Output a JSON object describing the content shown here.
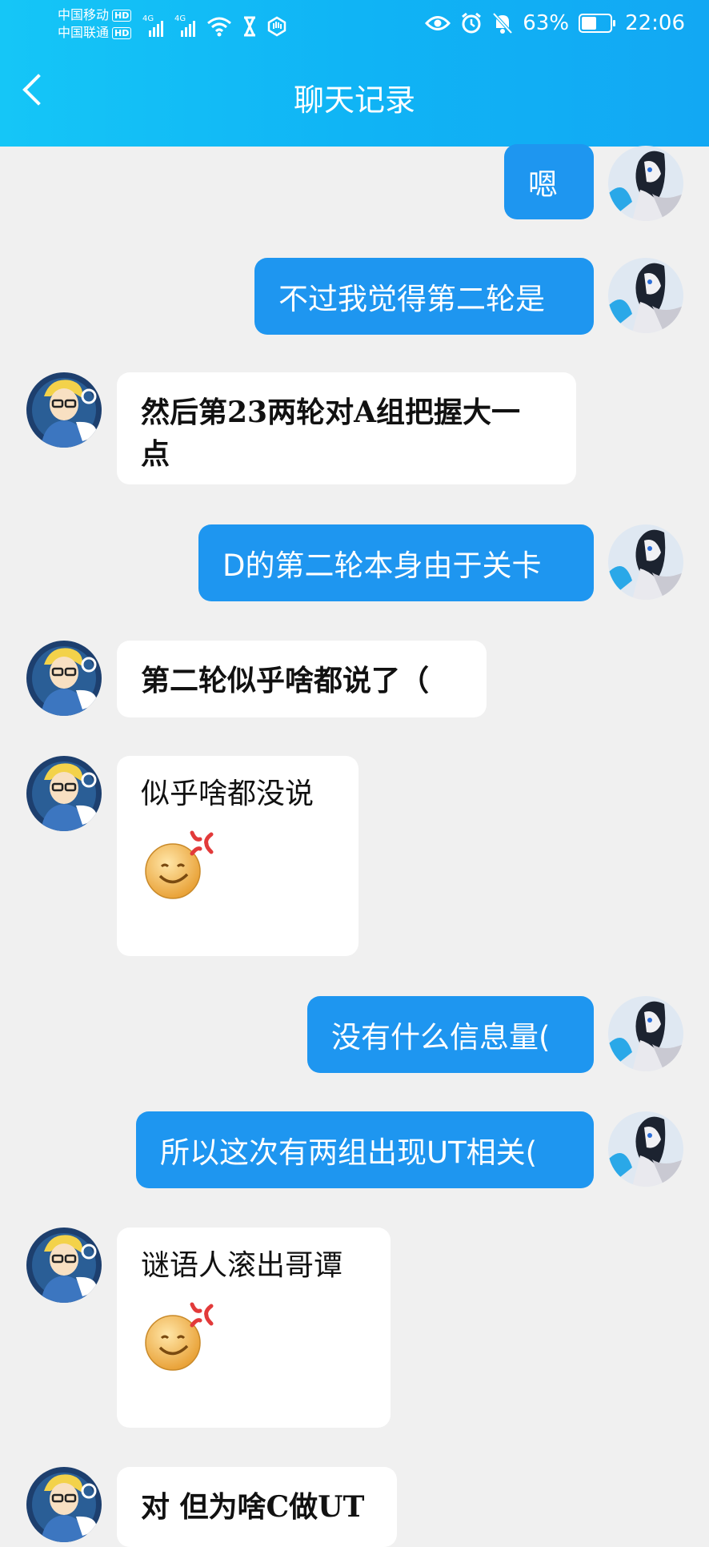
{
  "status_bar": {
    "carrier1": "中国移动",
    "carrier2": "中国联通",
    "hd_label": "HD",
    "net1": "4G",
    "net2": "4G",
    "battery_pct": "63%",
    "battery_level": 0.63,
    "time": "22:06"
  },
  "header": {
    "title": "聊天记录"
  },
  "messages": [
    {
      "side": "me",
      "text": "嗯"
    },
    {
      "side": "me",
      "text": "不过我觉得第二轮是"
    },
    {
      "side": "other",
      "lines": [
        "然后第23两轮对A组把握大一",
        "点"
      ]
    },
    {
      "side": "me",
      "text": "D的第二轮本身由于关卡"
    },
    {
      "side": "other",
      "lines": [
        "第二轮似乎啥都说了（"
      ]
    },
    {
      "side": "other",
      "lines": [
        "似乎啥都没说"
      ],
      "emoji": "angry-smile"
    },
    {
      "side": "me",
      "text": "没有什么信息量("
    },
    {
      "side": "me",
      "text": "所以这次有两组出现UT相关("
    },
    {
      "side": "other",
      "lines": [
        "谜语人滚出哥谭"
      ],
      "emoji": "angry-smile"
    },
    {
      "side": "other",
      "lines": [
        "对 但为啥C做UT"
      ]
    }
  ],
  "colors": {
    "header_bg": "#12b4f5",
    "my_bubble": "#1e96f0",
    "page_bg": "#f0f0f0"
  }
}
